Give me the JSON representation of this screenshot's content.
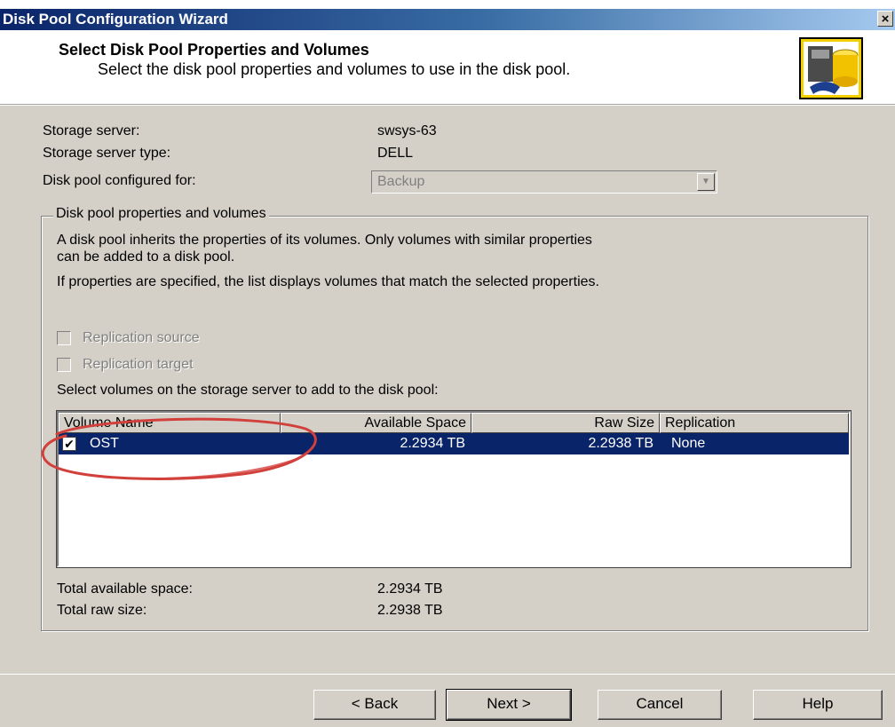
{
  "window": {
    "title": "Disk Pool Configuration Wizard",
    "close_glyph": "×"
  },
  "header": {
    "title": "Select Disk Pool Properties and Volumes",
    "subtitle": "Select the disk pool properties and volumes to use in the disk pool."
  },
  "info": {
    "storage_server_label": "Storage server:",
    "storage_server_value": "swsys-63",
    "storage_server_type_label": "Storage server type:",
    "storage_server_type_value": "DELL",
    "configured_for_label": "Disk pool configured for:",
    "configured_for_value": "Backup"
  },
  "group": {
    "legend": "Disk pool properties and volumes",
    "desc_line1": "A disk pool inherits the properties of its volumes. Only volumes with similar properties",
    "desc_line2": "can be added to a disk pool.",
    "desc_line3": "If properties are specified, the list displays volumes that match the selected properties.",
    "replication_source_label": "Replication source",
    "replication_target_label": "Replication target",
    "select_label": "Select volumes on the storage server to add to the disk pool:"
  },
  "table": {
    "columns": [
      "Volume Name",
      "Available Space",
      "Raw Size",
      "Replication"
    ],
    "rows": [
      {
        "checked": true,
        "name": "OST",
        "available": "2.2934 TB",
        "raw": "2.2938 TB",
        "replication": "None"
      }
    ]
  },
  "totals": {
    "available_label": "Total available space:",
    "available_value": "2.2934 TB",
    "raw_label": "Total raw size:",
    "raw_value": "2.2938 TB"
  },
  "buttons": {
    "back": "< Back",
    "next": "Next >",
    "cancel": "Cancel",
    "help": "Help"
  },
  "annotation": {
    "color": "#d2403c",
    "shape": "hand-drawn ellipse around the OST row"
  }
}
